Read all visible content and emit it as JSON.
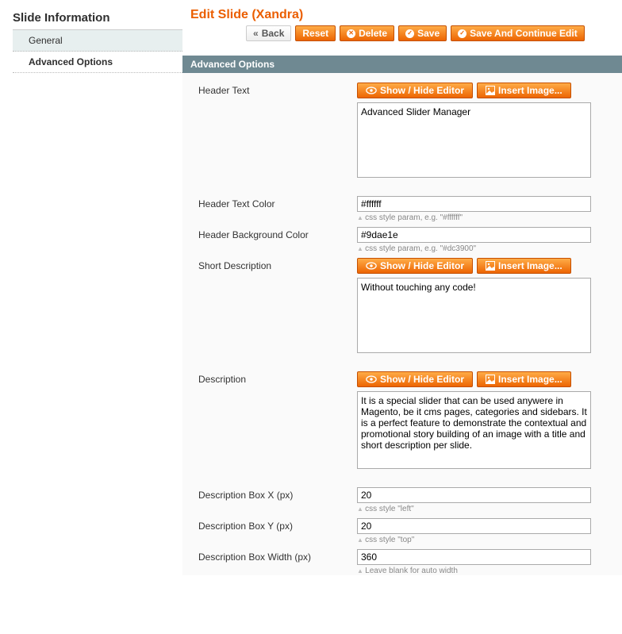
{
  "sidebar": {
    "title": "Slide Information",
    "items": [
      {
        "label": "General"
      },
      {
        "label": "Advanced Options"
      }
    ]
  },
  "page": {
    "title": "Edit Slide (Xandra)"
  },
  "buttons": {
    "back": "Back",
    "reset": "Reset",
    "delete": "Delete",
    "save": "Save",
    "save_continue": "Save And Continue Edit"
  },
  "section": {
    "title": "Advanced Options"
  },
  "editor_buttons": {
    "show_hide": "Show / Hide Editor",
    "insert_image": "Insert Image..."
  },
  "fields": {
    "header_text": {
      "label": "Header Text",
      "value": "Advanced Slider Manager"
    },
    "header_text_color": {
      "label": "Header Text Color",
      "value": "#ffffff",
      "hint": "css style param, e.g. \"#ffffff\""
    },
    "header_bg_color": {
      "label": "Header Background Color",
      "value": "#9dae1e",
      "hint": "css style param, e.g. \"#dc3900\""
    },
    "short_desc": {
      "label": "Short Description",
      "value": "Without touching any code!"
    },
    "description": {
      "label": "Description",
      "value": "It is a special slider that can be used anywere in Magento, be it cms pages, categories and sidebars. It is a perfect feature to demonstrate the contextual and promotional story building of an image with a title and short description per slide."
    },
    "desc_box_x": {
      "label": "Description Box X (px)",
      "value": "20",
      "hint": "css style \"left\""
    },
    "desc_box_y": {
      "label": "Description Box Y (px)",
      "value": "20",
      "hint": "css style \"top\""
    },
    "desc_box_width": {
      "label": "Description Box Width (px)",
      "value": "360",
      "hint": "Leave blank for auto width"
    }
  }
}
